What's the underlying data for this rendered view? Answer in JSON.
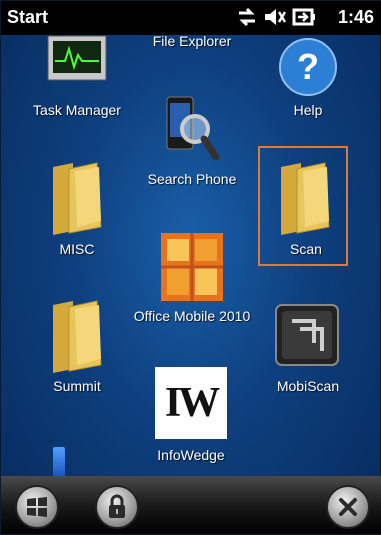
{
  "status": {
    "title": "Start",
    "time": "1:46",
    "icons": [
      "data-transfer-icon",
      "volume-muted-icon",
      "battery-plug-icon"
    ]
  },
  "apps": [
    {
      "label": "File Explorer",
      "icon": "file-explorer-icon"
    },
    {
      "label": "Task Manager",
      "icon": "task-manager-icon"
    },
    {
      "label": "Help",
      "icon": "help-icon"
    },
    {
      "label": "Search Phone",
      "icon": "search-phone-icon"
    },
    {
      "label": "MISC",
      "icon": "folder-icon"
    },
    {
      "label": "Scan",
      "icon": "folder-icon",
      "selected": true
    },
    {
      "label": "Office Mobile 2010",
      "icon": "office-icon"
    },
    {
      "label": "Summit",
      "icon": "folder-icon"
    },
    {
      "label": "MobiScan",
      "icon": "mobiscan-icon"
    },
    {
      "label": "InfoWedge",
      "icon": "infowedge-icon",
      "icon_text": "IW"
    }
  ],
  "softkeys": [
    "windows-start-icon",
    "lock-icon",
    "close-icon"
  ],
  "colors": {
    "selection": "#e07a2c",
    "folder": "#e8c55a",
    "office": "#e8731e",
    "help": "#2d7fd6"
  }
}
